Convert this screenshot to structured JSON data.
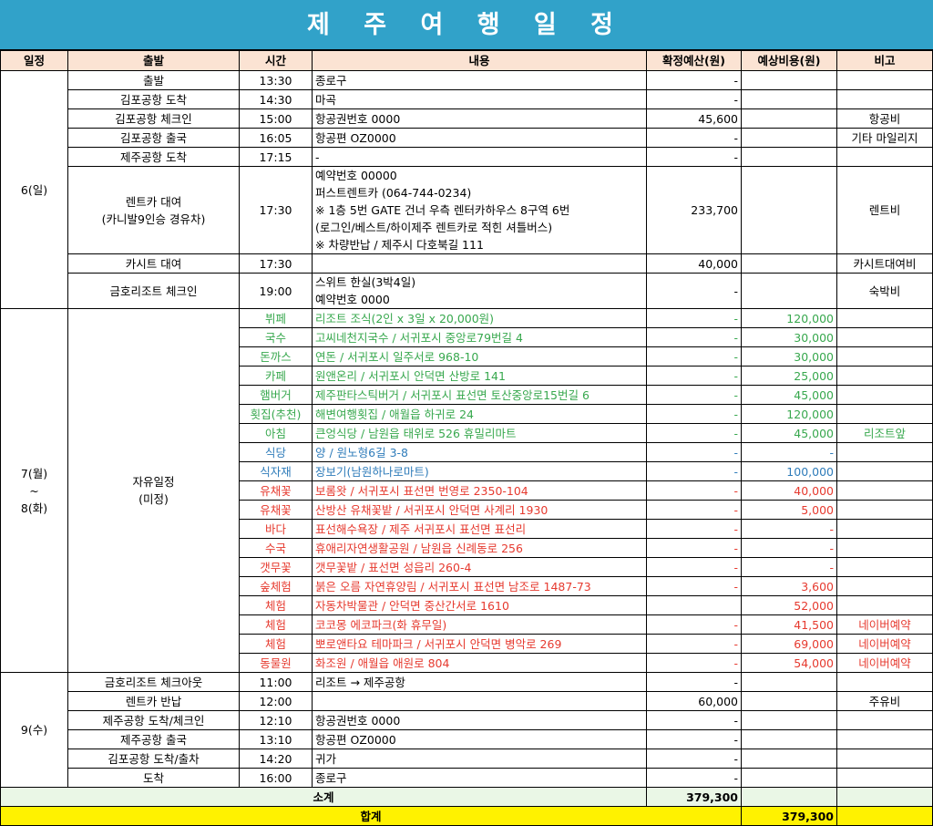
{
  "title": "제 주 여 행 일 정",
  "headers": [
    "일정",
    "출발",
    "시간",
    "내용",
    "확정예산(원)",
    "예상비용(원)",
    "비고"
  ],
  "day1": {
    "label": "6(일)",
    "rows": [
      {
        "dep": "출발",
        "time": "13:30",
        "content": [
          "종로구"
        ],
        "budget": "-",
        "est": "",
        "note": ""
      },
      {
        "dep": "김포공항 도착",
        "time": "14:30",
        "content": [
          "마곡"
        ],
        "budget": "-",
        "est": "",
        "note": ""
      },
      {
        "dep": "김포공항 체크인",
        "time": "15:00",
        "content": [
          "항공권번호 0000"
        ],
        "budget": "45,600",
        "est": "",
        "note": "항공비"
      },
      {
        "dep": "김포공항 출국",
        "time": "16:05",
        "content": [
          "항공편 OZ0000"
        ],
        "budget": "-",
        "est": "",
        "note": "기타 마일리지"
      },
      {
        "dep": "제주공항 도착",
        "time": "17:15",
        "content": [
          "-"
        ],
        "budget": "-",
        "est": "",
        "note": ""
      },
      {
        "dep": [
          "렌트카 대여",
          "(카니발9인승 경유차)"
        ],
        "time": "17:30",
        "content": [
          "예약번호 00000",
          "퍼스트렌트카 (064-744-0234)",
          "※ 1층 5번 GATE 건너 우측 렌터카하우스 8구역 6번",
          "(로그인/베스트/하이제주 렌트카로 적힌 셔틀버스)",
          "※ 차량반납 / 제주시 다호북길 111"
        ],
        "budget": "233,700",
        "est": "",
        "note": "렌트비"
      },
      {
        "dep": "카시트 대여",
        "time": "17:30",
        "content": [
          ""
        ],
        "budget": "40,000",
        "est": "",
        "note": "카시트대여비"
      },
      {
        "dep": "금호리조트 체크인",
        "time": "19:00",
        "content": [
          "스위트 한실(3박4일)",
          "예약번호 0000"
        ],
        "budget": "-",
        "est": "",
        "note": "숙박비"
      }
    ]
  },
  "day2": {
    "label": [
      "7(월)",
      "~",
      "8(화)"
    ],
    "dep": [
      "자유일정",
      "(미정)"
    ],
    "rows": [
      {
        "cat": "뷔페",
        "content": "리조트 조식(2인 x 3일 x 20,000원)",
        "budget": "-",
        "est": "120,000",
        "note": "",
        "color": "green"
      },
      {
        "cat": "국수",
        "content": "고씨네천지국수 / 서귀포시 중앙로79번길 4",
        "budget": "-",
        "est": "30,000",
        "note": "",
        "color": "green"
      },
      {
        "cat": "돈까스",
        "content": "연돈 / 서귀포시 일주서로 968-10",
        "budget": "-",
        "est": "30,000",
        "note": "",
        "color": "green"
      },
      {
        "cat": "카페",
        "content": "원앤온리 / 서귀포시 안덕면 산방로 141",
        "budget": "-",
        "est": "25,000",
        "note": "",
        "color": "green"
      },
      {
        "cat": "햄버거",
        "content": "제주판타스틱버거 / 서귀포시 표선면 토산중앙로15번길 6",
        "budget": "-",
        "est": "45,000",
        "note": "",
        "color": "green"
      },
      {
        "cat": "횟집(추천)",
        "content": "해변여행횟집 / 애월읍 하귀로 24",
        "budget": "-",
        "est": "120,000",
        "note": "",
        "color": "green"
      },
      {
        "cat": "아침",
        "content": "큰엉식당 / 남원읍 태위로 526 휴밀리마트",
        "budget": "-",
        "est": "45,000",
        "note": "리조트앞",
        "color": "green"
      },
      {
        "cat": "식당",
        "content": "양 / 원노형6길 3-8",
        "budget": "-",
        "est": "-",
        "note": "",
        "color": "blue"
      },
      {
        "cat": "식자재",
        "content": "장보기(남원하나로마트)",
        "budget": "-",
        "est": "100,000",
        "note": "",
        "color": "blue"
      },
      {
        "cat": "유채꽃",
        "content": "보롬왓 / 서귀포시 표선면 번영로 2350-104",
        "budget": "-",
        "est": "40,000",
        "note": "",
        "color": "red"
      },
      {
        "cat": "유채꽃",
        "content": "산방산 유채꽃밭 / 서귀포시 안덕면 사계리 1930",
        "budget": "-",
        "est": "5,000",
        "note": "",
        "color": "red"
      },
      {
        "cat": "바다",
        "content": "표선해수욕장 / 제주 서귀포시 표선면 표선리",
        "budget": "-",
        "est": "-",
        "note": "",
        "color": "red"
      },
      {
        "cat": "수국",
        "content": "휴애리자연생활공원 / 남원읍 신례동로 256",
        "budget": "-",
        "est": "-",
        "note": "",
        "color": "red"
      },
      {
        "cat": "갯무꽃",
        "content": "갯무꽃밭 / 표선면 성읍리 260-4",
        "budget": "-",
        "est": "-",
        "note": "",
        "color": "red"
      },
      {
        "cat": "숲체험",
        "content": "붉은 오름 자연휴양림 / 서귀포시 표선면 남조로 1487-73",
        "budget": "-",
        "est": "3,600",
        "note": "",
        "color": "red"
      },
      {
        "cat": "체험",
        "content": "자동차박물관 / 안덕면 중산간서로 1610",
        "budget": "",
        "est": "52,000",
        "note": "",
        "color": "red"
      },
      {
        "cat": "체험",
        "content": "코코몽 에코파크(화 휴무일)",
        "budget": "-",
        "est": "41,500",
        "note": "네이버예약",
        "color": "red"
      },
      {
        "cat": "체험",
        "content": "뽀로앤타요 테마파크 / 서귀포시 안덕면 병악로 269",
        "budget": "-",
        "est": "69,000",
        "note": "네이버예약",
        "color": "red"
      },
      {
        "cat": "동물원",
        "content": "화조원 / 애월읍 애원로 804",
        "budget": "-",
        "est": "54,000",
        "note": "네이버예약",
        "color": "red"
      }
    ]
  },
  "day3": {
    "label": "9(수)",
    "rows": [
      {
        "dep": "금호리조트 체크아웃",
        "time": "11:00",
        "content": "리조트 → 제주공항",
        "budget": "-",
        "est": "",
        "note": ""
      },
      {
        "dep": "렌트카 반납",
        "time": "12:00",
        "content": "",
        "budget": "60,000",
        "est": "",
        "note": "주유비"
      },
      {
        "dep": "제주공항 도착/체크인",
        "time": "12:10",
        "content": "항공권번호 0000",
        "budget": "-",
        "est": "",
        "note": ""
      },
      {
        "dep": "제주공항 출국",
        "time": "13:10",
        "content": "항공편 OZ0000",
        "budget": "-",
        "est": "",
        "note": ""
      },
      {
        "dep": "김포공항 도착/출차",
        "time": "14:20",
        "content": "귀가",
        "budget": "-",
        "est": "",
        "note": ""
      },
      {
        "dep": "도착",
        "time": "16:00",
        "content": "종로구",
        "budget": "-",
        "est": "",
        "note": ""
      }
    ]
  },
  "subtotal": {
    "label": "소계",
    "value": "379,300"
  },
  "total": {
    "label": "합계",
    "value": "379,300"
  }
}
